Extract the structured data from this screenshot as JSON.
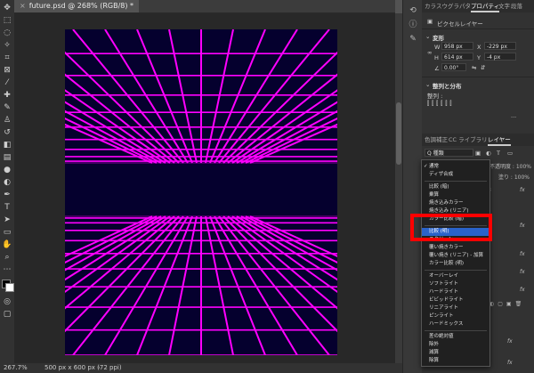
{
  "document": {
    "tab_title": "future.psd @ 268% (RGB/8) *"
  },
  "status": {
    "zoom": "267.7%",
    "doc_size": "500 px x 600 px (72 ppi)"
  },
  "panel_tabs": [
    "カラ",
    "スウ",
    "グラ",
    "パタ",
    "プロパティ",
    "文字",
    "段落"
  ],
  "properties": {
    "layer_type": "ピクセルレイヤー",
    "transform_title": "変形",
    "w_label": "W",
    "w_value": "958 px",
    "x_label": "X",
    "x_value": "-229 px",
    "h_label": "H",
    "h_value": "614 px",
    "y_label": "Y",
    "y_value": "-4 px",
    "angle_value": "0.00°",
    "align_title": "整列と分布",
    "align_label": "整列 :"
  },
  "layers_tabs": [
    "色調補正",
    "CC ライブラリ",
    "レイヤー"
  ],
  "layers_filter": "Q 種類",
  "layers_opacity_label": "不透明度 : 100%",
  "layers_fill_label": "塗り : 100%",
  "blend_modes": [
    {
      "label": "通常",
      "checked": true
    },
    {
      "label": "ディザ合成"
    },
    {
      "sep": true
    },
    {
      "label": "比較 (暗)"
    },
    {
      "label": "乗算"
    },
    {
      "label": "焼き込みカラー"
    },
    {
      "label": "焼き込み (リニア)"
    },
    {
      "label": "カラー比較 (暗)"
    },
    {
      "sep": true
    },
    {
      "label": "比較 (明)",
      "selected": true
    },
    {
      "label": "スクリーン"
    },
    {
      "label": "覆い焼きカラー"
    },
    {
      "label": "覆い焼き (リニア) - 加算"
    },
    {
      "label": "カラー比較 (明)"
    },
    {
      "sep": true
    },
    {
      "label": "オーバーレイ"
    },
    {
      "label": "ソフトライト"
    },
    {
      "label": "ハードライト"
    },
    {
      "label": "ビビッドライト"
    },
    {
      "label": "リニアライト"
    },
    {
      "label": "ピンライト"
    },
    {
      "label": "ハードミックス"
    },
    {
      "sep": true
    },
    {
      "label": "差の絶対値"
    },
    {
      "label": "除外"
    },
    {
      "label": "減算"
    },
    {
      "label": "除算"
    }
  ],
  "colors": {
    "grid_line": "#ff00ff",
    "artboard_bg": "#05002e",
    "highlight": "#ff0000",
    "selection": "#2a63c9"
  }
}
